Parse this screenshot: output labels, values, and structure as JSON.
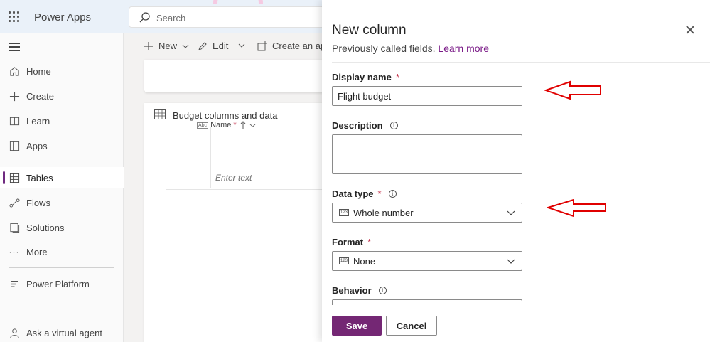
{
  "header": {
    "app_title": "Power Apps",
    "search_placeholder": "Search"
  },
  "command_bar": {
    "new_label": "New",
    "edit_label": "Edit",
    "create_app_label": "Create an app"
  },
  "sidebar": {
    "items": [
      {
        "label": "Home",
        "icon": "home-icon"
      },
      {
        "label": "Create",
        "icon": "plus-icon"
      },
      {
        "label": "Learn",
        "icon": "book-icon"
      },
      {
        "label": "Apps",
        "icon": "apps-icon"
      },
      {
        "label": "Tables",
        "icon": "table-icon",
        "active": true
      },
      {
        "label": "Flows",
        "icon": "flow-icon"
      },
      {
        "label": "Solutions",
        "icon": "solutions-icon"
      },
      {
        "label": "More",
        "icon": "more-icon"
      },
      {
        "label": "Power Platform",
        "icon": "power-platform-icon"
      },
      {
        "label": "Ask a virtual agent",
        "icon": "virtual-agent-icon"
      }
    ]
  },
  "grid": {
    "title": "Budget columns and data",
    "column_name": "Name",
    "column_required_marker": "*",
    "row_placeholder": "Enter text"
  },
  "panel": {
    "title": "New column",
    "subtitle": "Previously called fields.",
    "learn_more": "Learn more",
    "display_name": {
      "label": "Display name",
      "required": "*",
      "value": "Flight budget"
    },
    "description": {
      "label": "Description",
      "value": ""
    },
    "data_type": {
      "label": "Data type",
      "required": "*",
      "value": "Whole number"
    },
    "format": {
      "label": "Format",
      "required": "*",
      "value": "None"
    },
    "behavior": {
      "label": "Behavior"
    },
    "save_label": "Save",
    "cancel_label": "Cancel"
  },
  "colors": {
    "accent": "#742774",
    "link": "#7a1a87",
    "annotation_arrow": "#e00000"
  }
}
